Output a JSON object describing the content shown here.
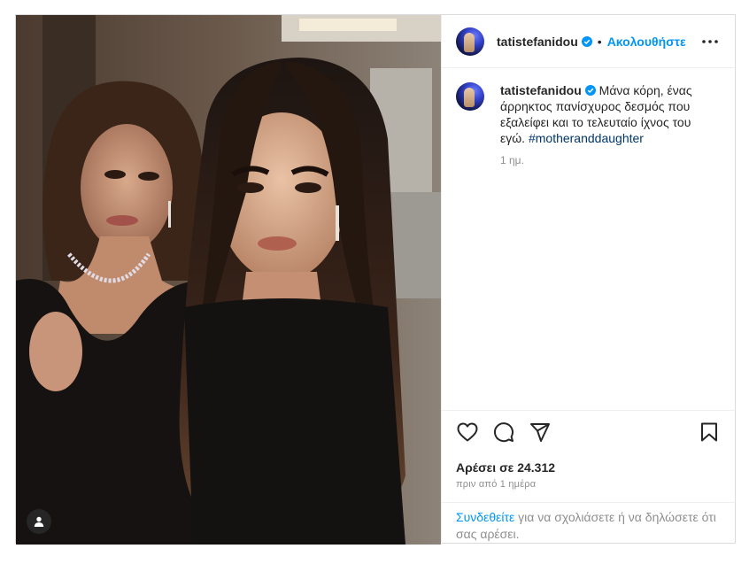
{
  "post": {
    "username": "tatistefanidou",
    "follow_label": "Ακολουθήστε",
    "dot": "•",
    "caption": "Μάνα κόρη, ένας άρρηκτος πανίσχυρος δεσμός που εξαλείφει και το τελευταίο ίχνος του εγώ.",
    "hashtag": "#motheranddaughter",
    "caption_age": "1 ημ.",
    "likes_text": "Αρέσει σε 24.312",
    "posted_text": "πριν από 1 ημέρα",
    "login_link": "Συνδεθείτε",
    "login_rest": " για να σχολιάσετε ή να δηλώσετε ότι σας αρέσει."
  },
  "icons": {
    "verified": "verified-badge-icon",
    "more": "more-options-icon",
    "like": "heart-icon",
    "comment": "comment-icon",
    "share": "share-icon",
    "save": "bookmark-icon",
    "tagged": "tagged-user-icon"
  },
  "colors": {
    "link_blue": "#0095f6",
    "hashtag_blue": "#00376b",
    "secondary_text": "#8e8e8e",
    "border": "#dbdbdb"
  }
}
